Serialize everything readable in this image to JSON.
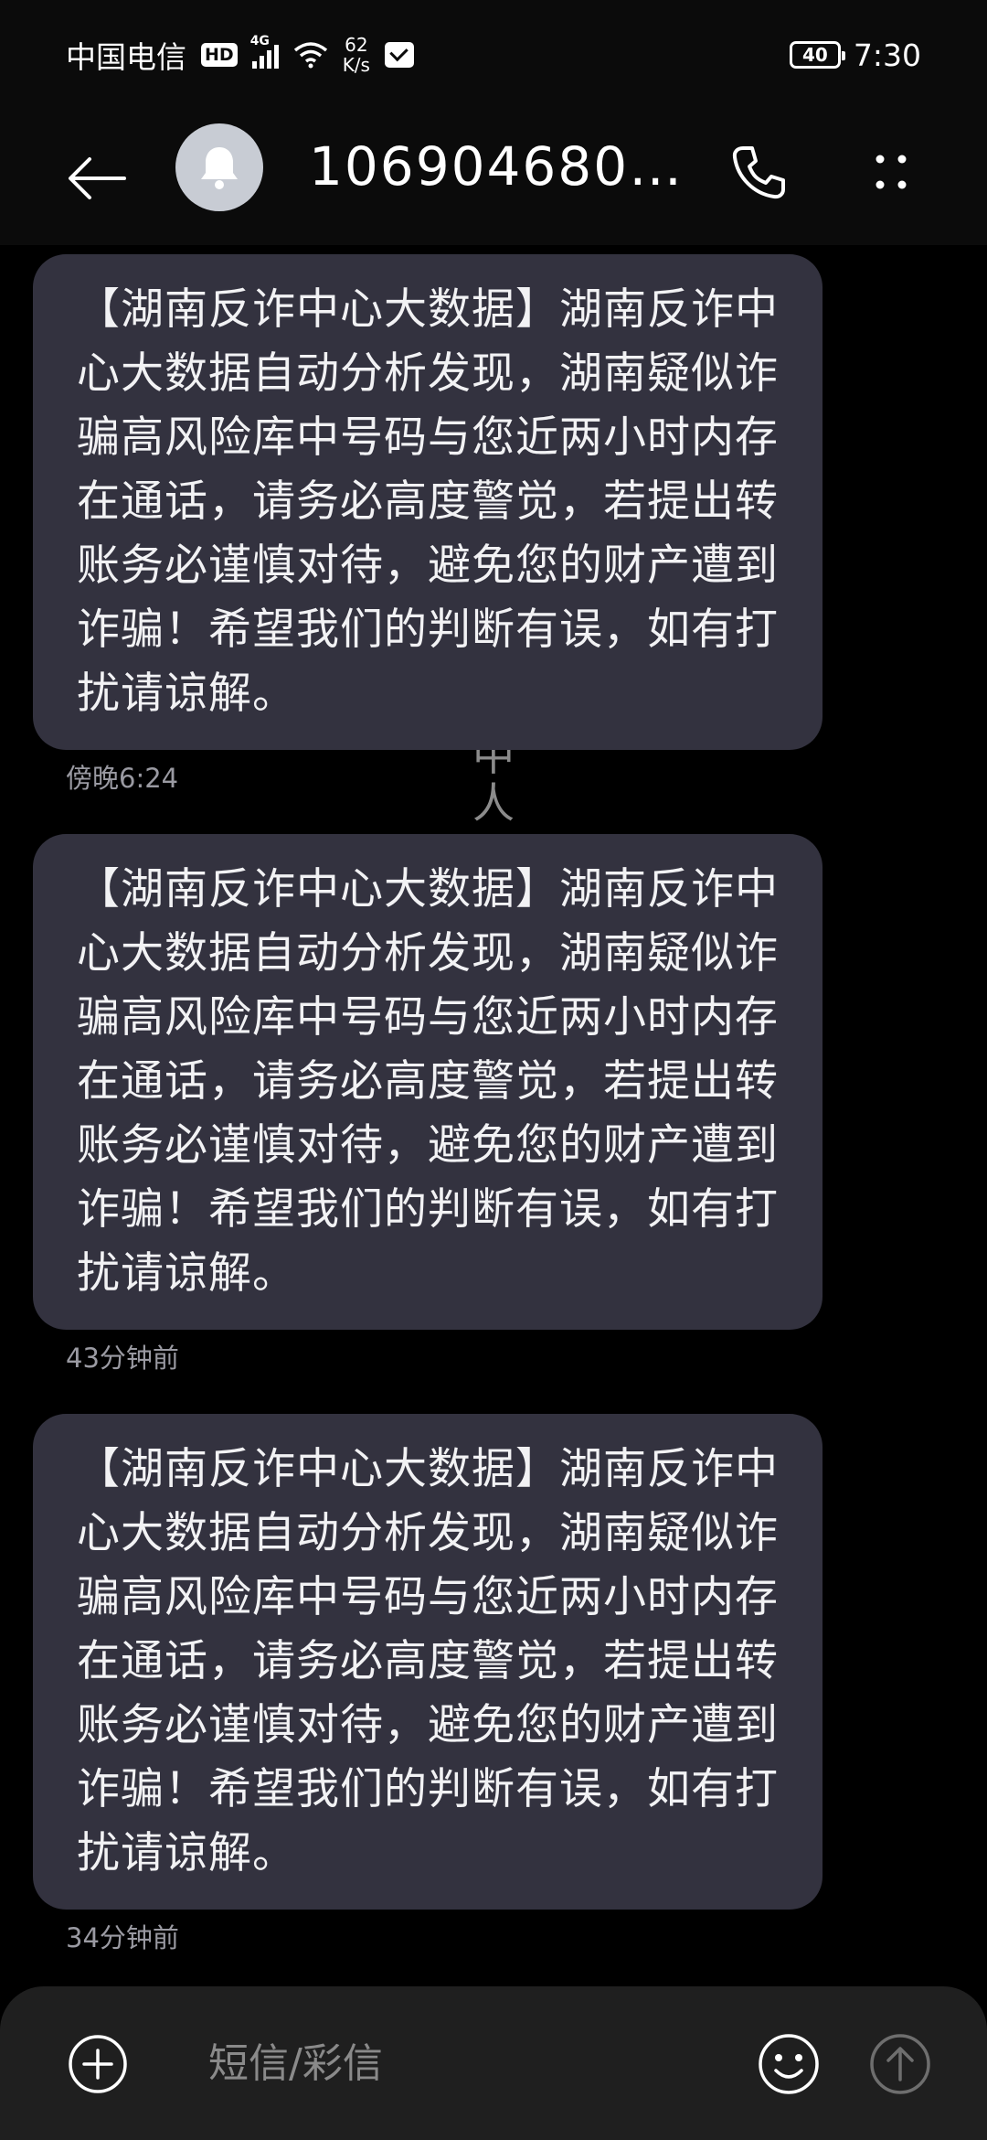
{
  "status_bar": {
    "carrier": "中国电信",
    "hd": "HD",
    "network": "4G",
    "speed_value": "62",
    "speed_unit": "K/s",
    "battery": "40",
    "time": "7:30"
  },
  "header": {
    "contact": "1069046802..."
  },
  "background_text": [
    "中",
    "人"
  ],
  "messages": [
    {
      "text": "【湖南反诈中心大数据】湖南反诈中心大数据自动分析发现，湖南疑似诈骗高风险库中号码与您近两小时内存在通话，请务必高度警觉，若提出转账务必谨慎对待，避免您的财产遭到诈骗！希望我们的判断有误，如有打扰请谅解。",
      "time": "傍晚6:24"
    },
    {
      "text": "【湖南反诈中心大数据】湖南反诈中心大数据自动分析发现，湖南疑似诈骗高风险库中号码与您近两小时内存在通话，请务必高度警觉，若提出转账务必谨慎对待，避免您的财产遭到诈骗！希望我们的判断有误，如有打扰请谅解。",
      "time": "43分钟前"
    },
    {
      "text": "【湖南反诈中心大数据】湖南反诈中心大数据自动分析发现，湖南疑似诈骗高风险库中号码与您近两小时内存在通话，请务必高度警觉，若提出转账务必谨慎对待，避免您的财产遭到诈骗！希望我们的判断有误，如有打扰请谅解。",
      "time": "34分钟前"
    }
  ],
  "composer": {
    "placeholder": "短信/彩信"
  },
  "icons": {
    "back": "back-arrow-icon",
    "avatar": "bell-icon",
    "call": "phone-icon",
    "more": "more-dots-icon",
    "add": "plus-circle-icon",
    "emoji": "smiley-icon",
    "send": "send-arrow-icon"
  },
  "colors": {
    "background": "#000000",
    "bubble": "#33323f",
    "timestamp": "#9a9aa2",
    "composer": "#1f1f1f"
  }
}
